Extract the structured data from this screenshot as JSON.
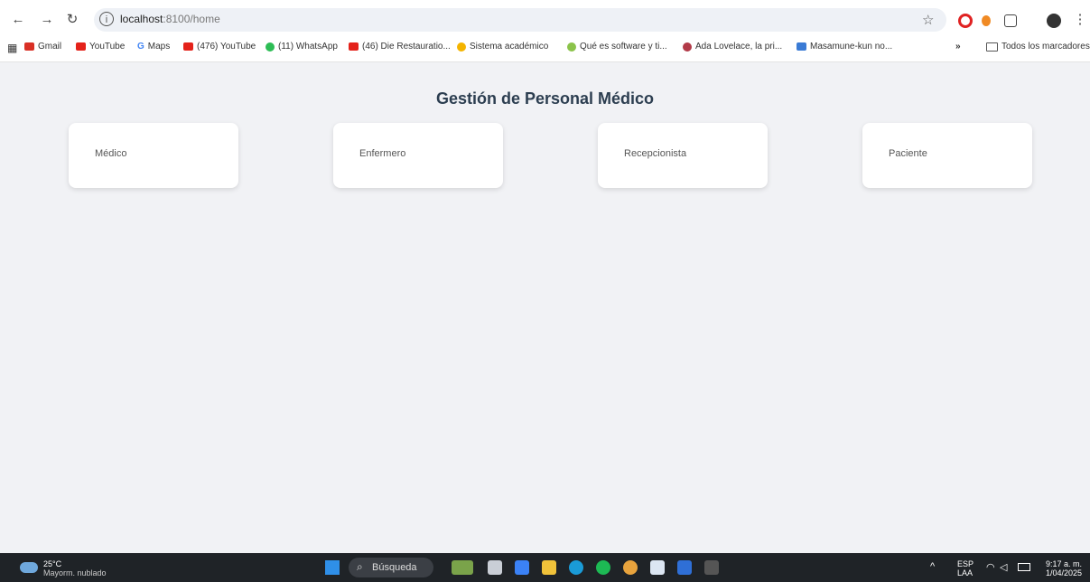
{
  "browser": {
    "url_host": "localhost",
    "url_path": ":8100/home",
    "bookmarks": [
      {
        "label": "Gmail",
        "color": "#d93025"
      },
      {
        "label": "YouTube",
        "color": "#e4221a"
      },
      {
        "label": "Maps",
        "color": "#4285f4"
      },
      {
        "label": "(476) YouTube",
        "color": "#e4221a"
      },
      {
        "label": "(11) WhatsApp",
        "color": "#25d366"
      },
      {
        "label": "(46) Die Restauratio...",
        "color": "#e4221a"
      },
      {
        "label": "Sistema académico",
        "color": "#f4b400"
      },
      {
        "label": "Qué es software y ti...",
        "color": "#8bc34a"
      },
      {
        "label": "Ada Lovelace, la pri...",
        "color": "#b23a48"
      },
      {
        "label": "Masamune-kun no...",
        "color": "#3a7bd5"
      }
    ],
    "more": "»",
    "all_bookmarks": "Todos los marcadores"
  },
  "page": {
    "title": "Gestión de Personal Médico",
    "cards": [
      {
        "label": "Médico"
      },
      {
        "label": "Enfermero"
      },
      {
        "label": "Recepcionista"
      },
      {
        "label": "Paciente"
      }
    ]
  },
  "taskbar": {
    "temp": "25°C",
    "weather": "Mayorm. nublado",
    "search_placeholder": "Búsqueda",
    "lang_top": "ESP",
    "lang_bottom": "LAA",
    "time": "9:17 a. m.",
    "date": "1/04/2025"
  }
}
